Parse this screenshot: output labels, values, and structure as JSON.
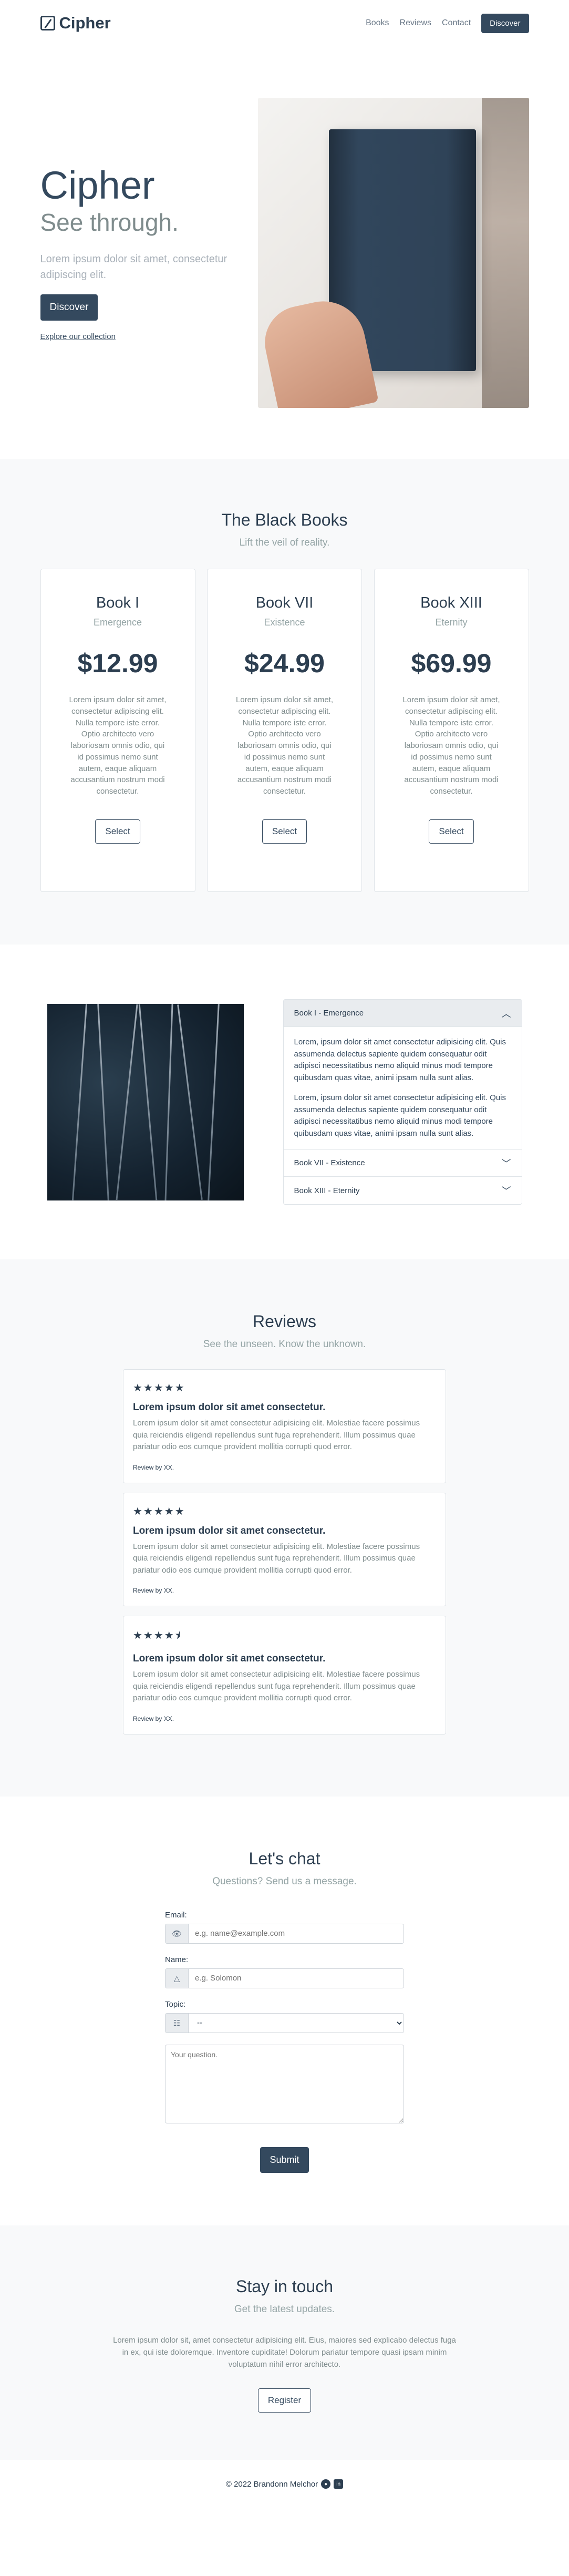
{
  "nav": {
    "brand": "Cipher",
    "links": [
      "Books",
      "Reviews",
      "Contact"
    ],
    "cta": "Discover"
  },
  "hero": {
    "title": "Cipher",
    "subtitle": "See through.",
    "tagline": "Lorem ipsum dolor sit amet, consectetur adipiscing elit.",
    "button": "Discover",
    "link": "Explore our collection"
  },
  "pricing": {
    "title": "The Black Books",
    "subtitle": "Lift the veil of reality.",
    "cards": [
      {
        "title": "Book I",
        "sub": "Emergence",
        "price": "$12.99",
        "desc": "Lorem ipsum dolor sit amet, consectetur adipiscing elit. Nulla tempore iste error. Optio architecto vero laboriosam omnis odio, qui id possimus nemo sunt autem, eaque aliquam accusantium nostrum modi consectetur.",
        "button": "Select"
      },
      {
        "title": "Book VII",
        "sub": "Existence",
        "price": "$24.99",
        "desc": "Lorem ipsum dolor sit amet, consectetur adipiscing elit. Nulla tempore iste error. Optio architecto vero laboriosam omnis odio, qui id possimus nemo sunt autem, eaque aliquam accusantium nostrum modi consectetur.",
        "button": "Select"
      },
      {
        "title": "Book XIII",
        "sub": "Eternity",
        "price": "$69.99",
        "desc": "Lorem ipsum dolor sit amet, consectetur adipiscing elit. Nulla tempore iste error. Optio architecto vero laboriosam omnis odio, qui id possimus nemo sunt autem, eaque aliquam accusantium nostrum modi consectetur.",
        "button": "Select"
      }
    ]
  },
  "accordion": {
    "items": [
      {
        "title": "Book I - Emergence",
        "open": true
      },
      {
        "title": "Book VII - Existence",
        "open": false
      },
      {
        "title": "Book XIII - Eternity",
        "open": false
      }
    ],
    "body": [
      "Lorem, ipsum dolor sit amet consectetur adipisicing elit. Quis assumenda delectus sapiente quidem consequatur odit adipisci necessitatibus nemo aliquid minus modi tempore quibusdam quas vitae, animi ipsam nulla sunt alias.",
      "Lorem, ipsum dolor sit amet consectetur adipisicing elit. Quis assumenda delectus sapiente quidem consequatur odit adipisci necessitatibus nemo aliquid minus modi tempore quibusdam quas vitae, animi ipsam nulla sunt alias."
    ]
  },
  "reviews": {
    "title": "Reviews",
    "subtitle": "See the unseen. Know the unknown.",
    "items": [
      {
        "stars": "★★★★★",
        "rating": 5,
        "title": "Lorem ipsum dolor sit amet consectetur.",
        "text": "Lorem ipsum dolor sit amet consectetur adipisicing elit. Molestiae facere possimus quia reiciendis eligendi repellendus sunt fuga reprehenderit. Illum possimus quae pariatur odio eos cumque provident mollitia corrupti quod error.",
        "by": "Review by XX."
      },
      {
        "stars": "★★★★★",
        "rating": 5,
        "title": "Lorem ipsum dolor sit amet consectetur.",
        "text": "Lorem ipsum dolor sit amet consectetur adipisicing elit. Molestiae facere possimus quia reiciendis eligendi repellendus sunt fuga reprehenderit. Illum possimus quae pariatur odio eos cumque provident mollitia corrupti quod error.",
        "by": "Review by XX."
      },
      {
        "stars": "★★★★⯨",
        "rating": 4.5,
        "title": "Lorem ipsum dolor sit amet consectetur.",
        "text": "Lorem ipsum dolor sit amet consectetur adipisicing elit. Molestiae facere possimus quia reiciendis eligendi repellendus sunt fuga reprehenderit. Illum possimus quae pariatur odio eos cumque provident mollitia corrupti quod error.",
        "by": "Review by XX."
      }
    ]
  },
  "contact": {
    "title": "Let's chat",
    "subtitle": "Questions? Send us a message.",
    "email_label": "Email:",
    "email_placeholder": "e.g. name@example.com",
    "name_label": "Name:",
    "name_placeholder": "e.g. Solomon",
    "topic_label": "Topic:",
    "topic_value": "--",
    "question_placeholder": "Your question.",
    "submit": "Submit"
  },
  "newsletter": {
    "title": "Stay in touch",
    "subtitle": "Get the latest updates.",
    "copy": "Lorem ipsum dolor sit, amet consectetur adipisicing elit. Eius, maiores sed explicabo delectus fuga in ex, qui iste doloremque. Inventore cupiditate! Dolorum pariatur tempore quasi ipsam minim voluptatum nihil error architecto.",
    "button": "Register"
  },
  "footer": {
    "copyright": "© 2022 Brandonn Melchor"
  }
}
